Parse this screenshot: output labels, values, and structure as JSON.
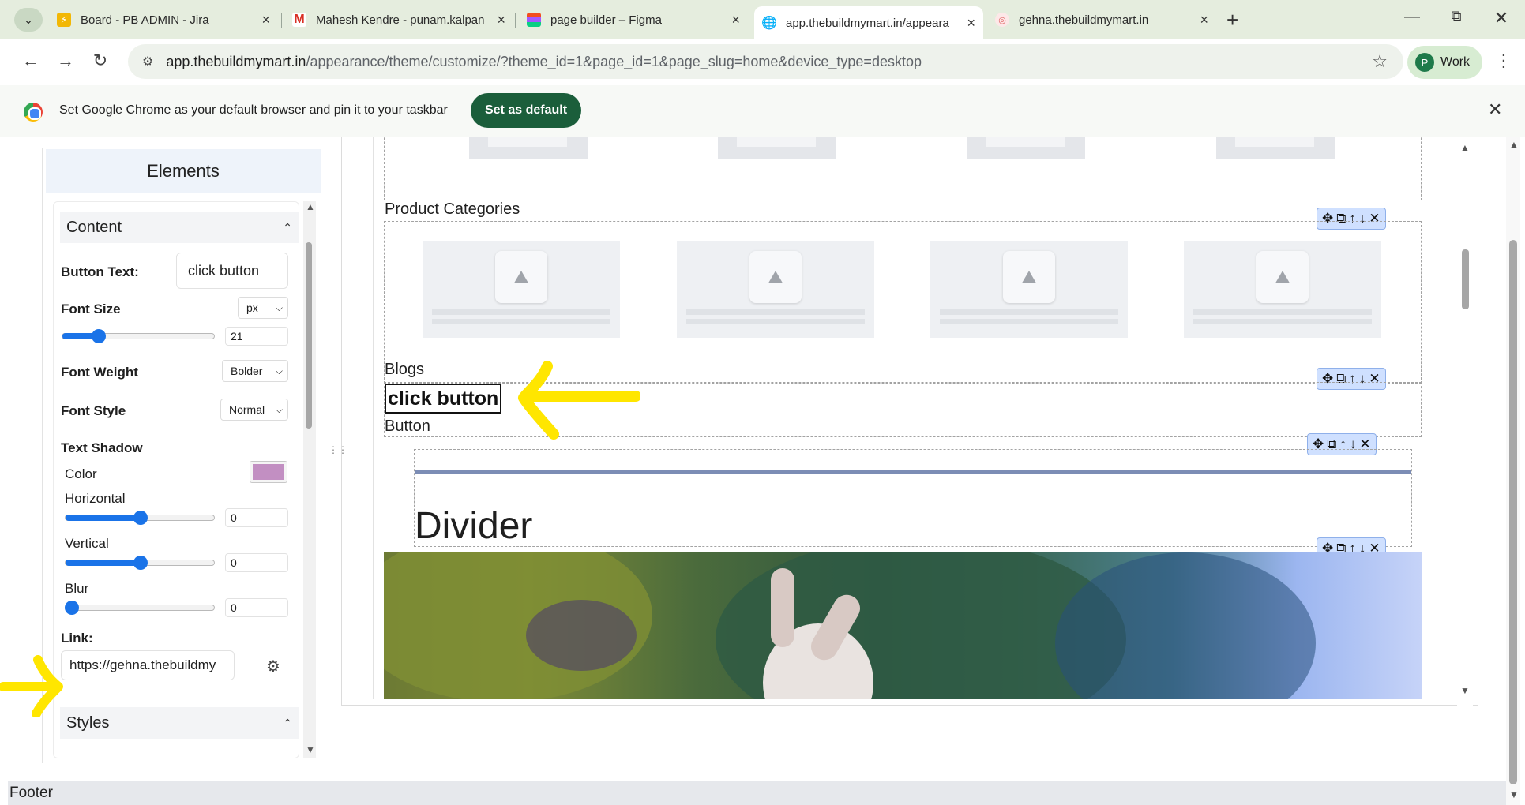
{
  "browser": {
    "tabs": [
      {
        "title": "Board - PB ADMIN - Jira",
        "icon": "jira-icon",
        "active": false
      },
      {
        "title": "Mahesh Kendre - punam.kalpan",
        "icon": "gmail-icon",
        "active": false
      },
      {
        "title": "page builder – Figma",
        "icon": "figma-icon",
        "active": false
      },
      {
        "title": "app.thebuildmymart.in/appeara",
        "icon": "globe-icon",
        "active": true
      },
      {
        "title": "gehna.thebuildmymart.in",
        "icon": "site-icon",
        "active": false
      }
    ],
    "url_host": "app.thebuildmymart.in",
    "url_path": "/appearance/theme/customize/?theme_id=1&page_id=1&page_slug=home&device_type=desktop",
    "profile_label": "Work",
    "profile_initial": "P",
    "infobar_message": "Set Google Chrome as your default browser and pin it to your taskbar",
    "infobar_button": "Set as default"
  },
  "sidebar": {
    "title": "Elements",
    "content_section": "Content",
    "button_text_label": "Button Text:",
    "button_text_value": "click button",
    "font_size_label": "Font Size",
    "font_size_unit": "px",
    "font_size_value": "21",
    "font_weight_label": "Font Weight",
    "font_weight_value": "Bolder",
    "font_style_label": "Font Style",
    "font_style_value": "Normal",
    "text_shadow_label": "Text Shadow",
    "color_label": "Color",
    "shadow_color": "#c28fc2",
    "horizontal_label": "Horizontal",
    "horizontal_value": "0",
    "vertical_label": "Vertical",
    "vertical_value": "0",
    "blur_label": "Blur",
    "blur_value": "0",
    "link_label": "Link:",
    "link_value": "https://gehna.thebuildmy",
    "styles_section": "Styles"
  },
  "canvas": {
    "product_categories_label": "Product Categories",
    "blogs_label": "Blogs",
    "button_preview_text": "click button",
    "button_label": "Button",
    "divider_label": "Divider"
  },
  "footer": {
    "label": "Footer"
  },
  "colors": {
    "accent": "#1a73e8",
    "annotation_arrow": "#ffe600",
    "infobar_button": "#1b5e3b",
    "divider": "#7c8db5"
  }
}
